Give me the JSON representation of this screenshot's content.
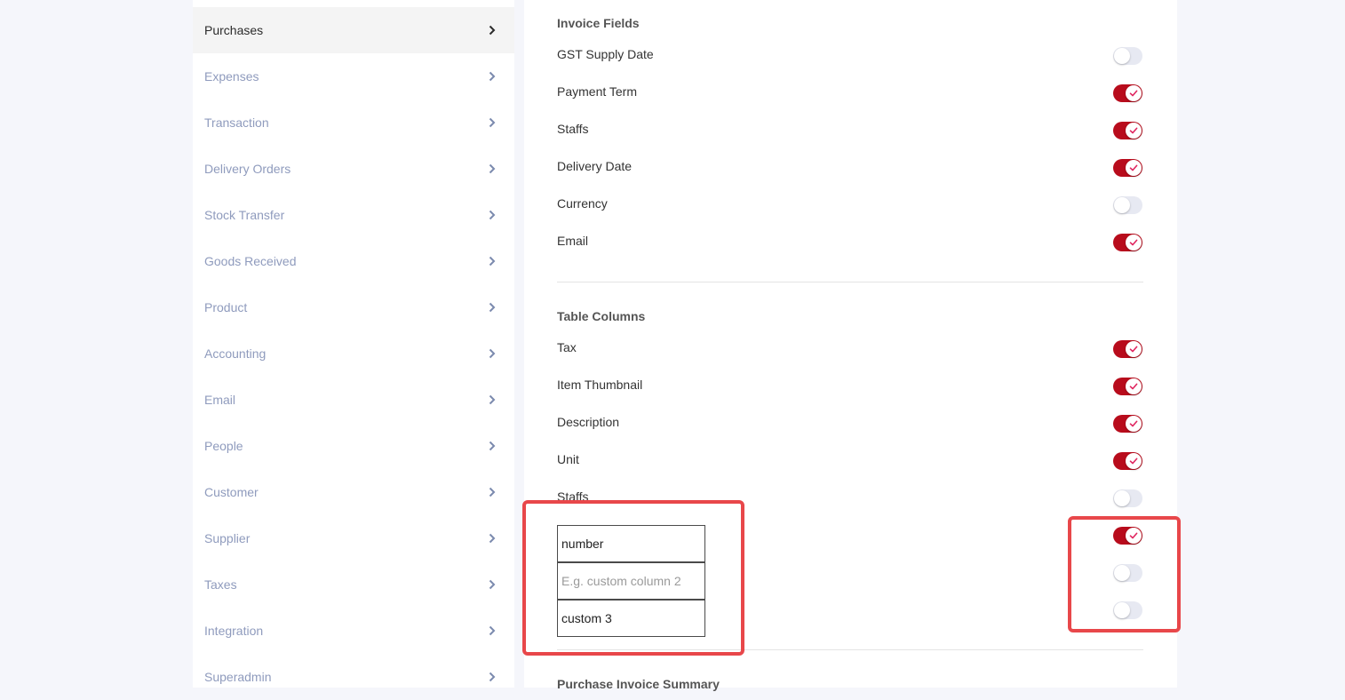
{
  "sidebar": {
    "items": [
      {
        "label": "Purchases",
        "active": true
      },
      {
        "label": "Expenses"
      },
      {
        "label": "Transaction"
      },
      {
        "label": "Delivery Orders"
      },
      {
        "label": "Stock Transfer"
      },
      {
        "label": "Goods Received"
      },
      {
        "label": "Product"
      },
      {
        "label": "Accounting"
      },
      {
        "label": "Email"
      },
      {
        "label": "People"
      },
      {
        "label": "Customer"
      },
      {
        "label": "Supplier"
      },
      {
        "label": "Taxes"
      },
      {
        "label": "Integration"
      },
      {
        "label": "Superadmin"
      }
    ]
  },
  "invoice_fields": {
    "title": "Invoice Fields",
    "rows": [
      {
        "label": "GST Supply Date",
        "on": false
      },
      {
        "label": "Payment Term",
        "on": true
      },
      {
        "label": "Staffs",
        "on": true
      },
      {
        "label": "Delivery Date",
        "on": true
      },
      {
        "label": "Currency",
        "on": false
      },
      {
        "label": "Email",
        "on": true
      }
    ]
  },
  "table_columns": {
    "title": "Table Columns",
    "rows": [
      {
        "label": "Tax",
        "on": true
      },
      {
        "label": "Item Thumbnail",
        "on": true
      },
      {
        "label": "Description",
        "on": true
      },
      {
        "label": "Unit",
        "on": true
      },
      {
        "label": "Staffs",
        "on": false
      }
    ],
    "custom_columns": [
      {
        "value": "number",
        "placeholder": "",
        "on": true
      },
      {
        "value": "",
        "placeholder": "E.g. custom column 2",
        "on": false
      },
      {
        "value": "custom 3",
        "placeholder": "",
        "on": false
      }
    ]
  },
  "summary": {
    "title": "Purchase Invoice Summary"
  },
  "colors": {
    "toggle_on": "#b80c1c",
    "toggle_off": "#e7e9f2",
    "check": "#e0245e",
    "highlight": "#e8474a"
  }
}
